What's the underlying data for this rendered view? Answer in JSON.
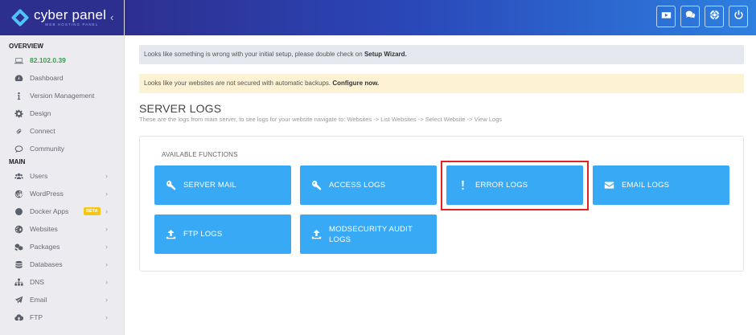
{
  "brand": {
    "name": "cyber panel",
    "sub": "WEB HOSTING PANEL",
    "collapse": "‹"
  },
  "sidebar": {
    "overview_label": "OVERVIEW",
    "main_label": "MAIN",
    "overview_items": [
      {
        "label": "82.102.0.39",
        "icon": "laptop-icon"
      },
      {
        "label": "Dashboard",
        "icon": "dashboard-icon"
      },
      {
        "label": "Version Management",
        "icon": "info-icon"
      },
      {
        "label": "Design",
        "icon": "gear-icon"
      },
      {
        "label": "Connect",
        "icon": "link-icon"
      },
      {
        "label": "Community",
        "icon": "comments-icon"
      }
    ],
    "main_items": [
      {
        "label": "Users",
        "icon": "users-icon"
      },
      {
        "label": "WordPress",
        "icon": "wordpress-icon"
      },
      {
        "label": "Docker Apps",
        "icon": "docker-icon",
        "badge": "BETA"
      },
      {
        "label": "Websites",
        "icon": "globe-icon"
      },
      {
        "label": "Packages",
        "icon": "packages-icon"
      },
      {
        "label": "Databases",
        "icon": "database-icon"
      },
      {
        "label": "DNS",
        "icon": "sitemap-icon"
      },
      {
        "label": "Email",
        "icon": "paper-plane-icon"
      },
      {
        "label": "FTP",
        "icon": "cloud-upload-icon"
      }
    ],
    "arrow": "›"
  },
  "alerts": {
    "setup_text": "Looks like something is wrong with your initial setup, please double check on ",
    "setup_link": "Setup Wizard.",
    "backup_text": "Looks like your websites are not secured with automatic backups. ",
    "backup_link": "Configure now."
  },
  "page": {
    "title": "SERVER LOGS",
    "subtitle": "These are the logs from main server, to see logs for your website navigate to: Websites -> List Websites -> Select Website -> View Logs"
  },
  "functions": {
    "heading": "AVAILABLE FUNCTIONS",
    "server_mail": "SERVER MAIL",
    "access_logs": "ACCESS LOGS",
    "error_logs": "ERROR LOGS",
    "email_logs": "EMAIL LOGS",
    "ftp_logs": "FTP LOGS",
    "modsec_line1": "MODSECURITY AUDIT",
    "modsec_line2": "LOGS"
  },
  "colors": {
    "accent": "#38a9f5",
    "highlight": "#e02424",
    "topbar": "#2d2f8f",
    "ip": "#3a9c52"
  }
}
